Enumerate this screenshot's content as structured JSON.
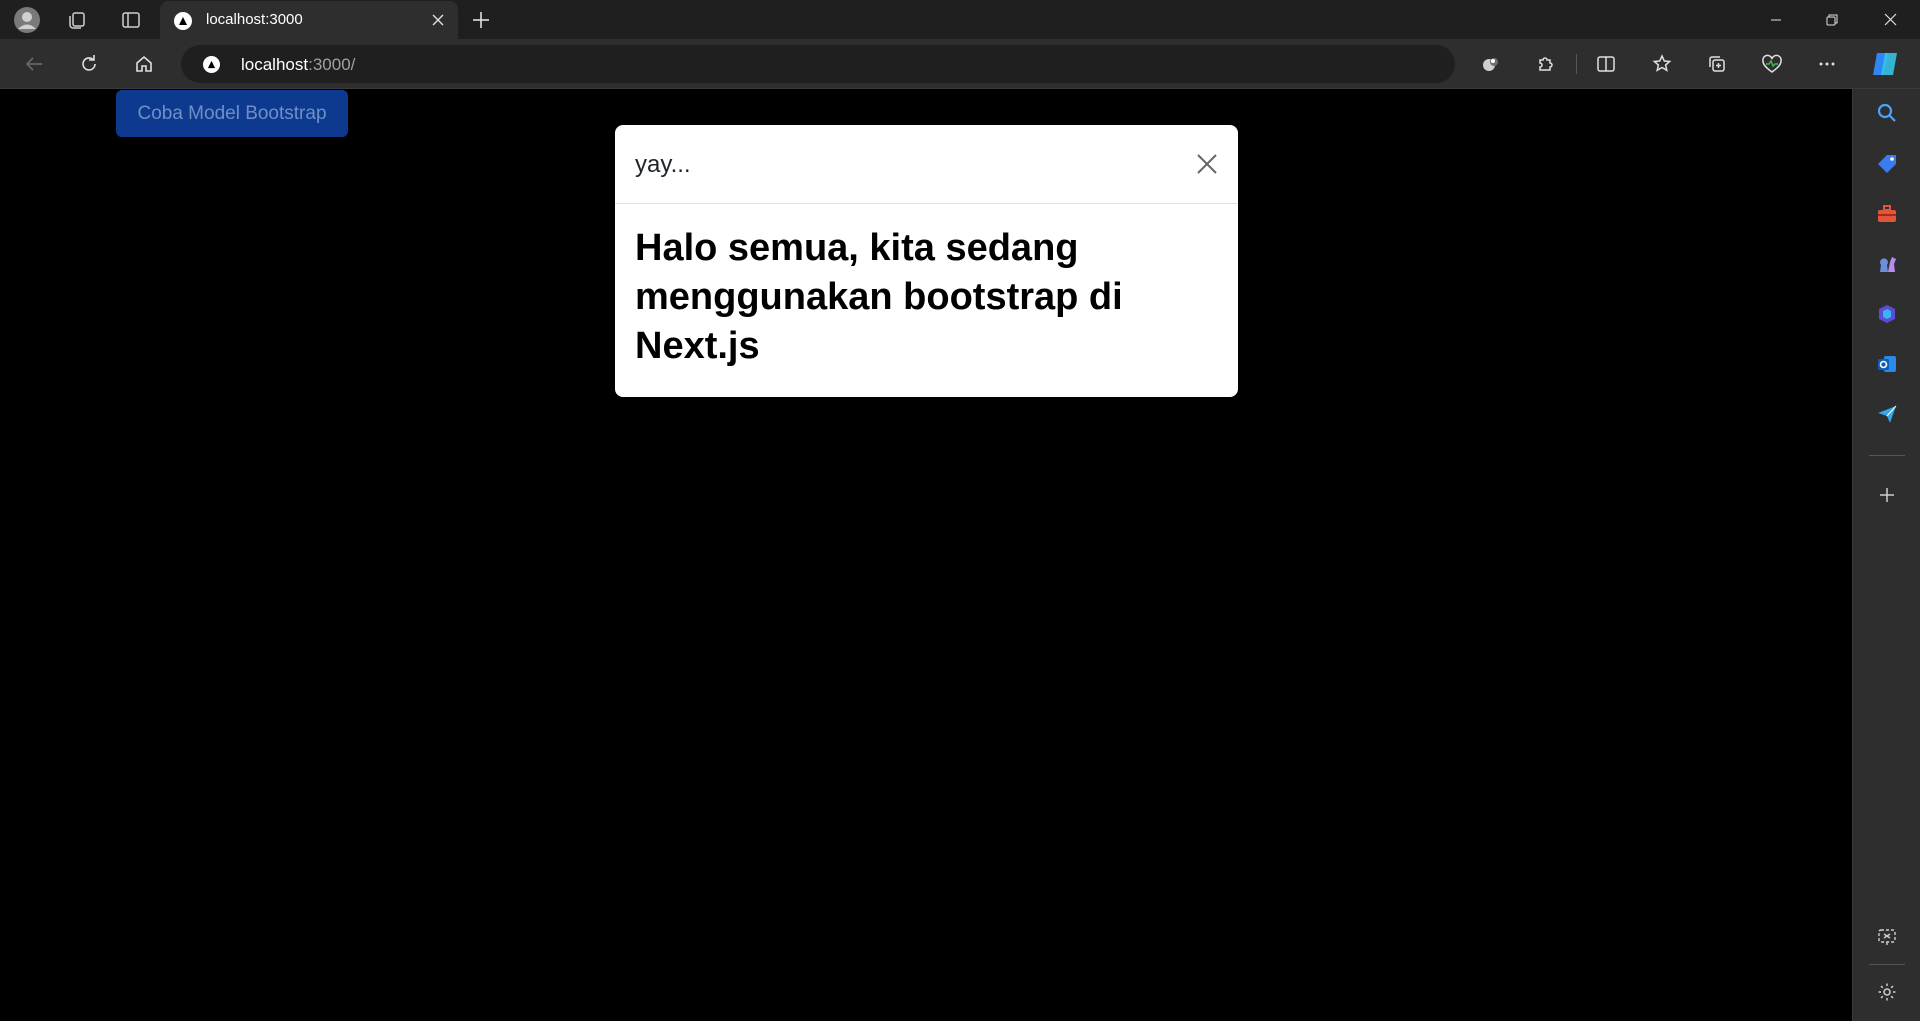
{
  "browser": {
    "tab": {
      "title": "localhost:3000"
    },
    "address": {
      "host": "localhost",
      "path": ":3000/"
    }
  },
  "page": {
    "open_button_label": "Coba Model Bootstrap",
    "modal": {
      "title": "yay...",
      "body": "Halo semua, kita sedang menggunakan bootstrap di Next.js"
    }
  },
  "colors": {
    "chrome_dark": "#1f1f1f",
    "toolbar": "#2e2e2e",
    "button_primary": "#0d3a8f",
    "modal_bg": "#ffffff",
    "page_bg": "#000000"
  }
}
